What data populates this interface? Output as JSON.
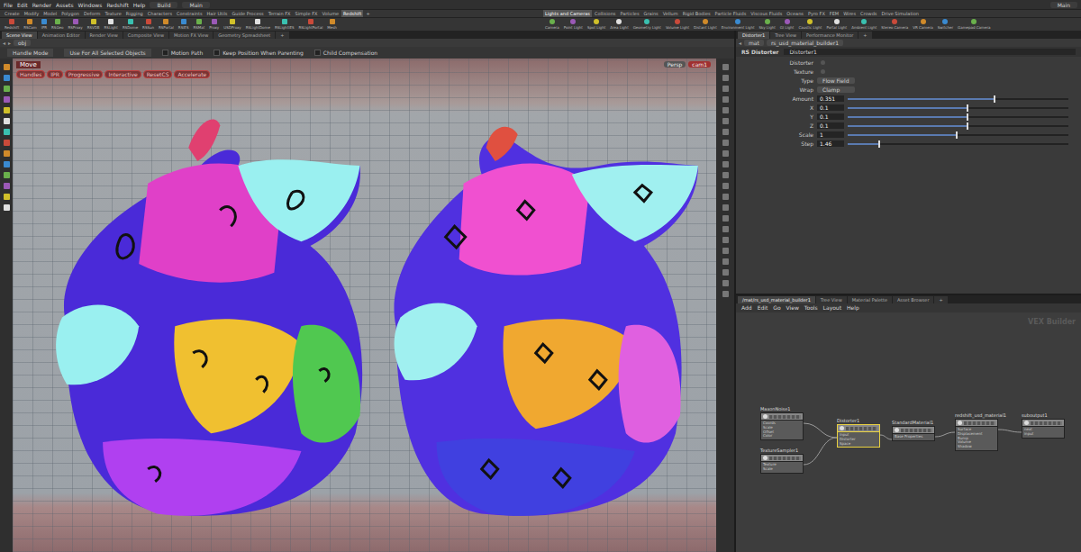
{
  "menubar": {
    "items": [
      "File",
      "Edit",
      "Render",
      "Assets",
      "Windows",
      "Redshift",
      "Help"
    ],
    "desktop": "Build",
    "context": "Main",
    "right_context": "Main"
  },
  "shelf_tabs_left": [
    {
      "label": "Create",
      "selected": false
    },
    {
      "label": "Modify",
      "selected": false
    },
    {
      "label": "Model",
      "selected": false
    },
    {
      "label": "Polygon",
      "selected": false
    },
    {
      "label": "Deform",
      "selected": false
    },
    {
      "label": "Texture",
      "selected": false
    },
    {
      "label": "Rigging",
      "selected": false
    },
    {
      "label": "Characters",
      "selected": false
    },
    {
      "label": "Constraints",
      "selected": false
    },
    {
      "label": "Hair Utils",
      "selected": false
    },
    {
      "label": "Guide Process",
      "selected": false
    },
    {
      "label": "Terrain FX",
      "selected": false
    },
    {
      "label": "Simple FX",
      "selected": false
    },
    {
      "label": "Volume",
      "selected": false
    },
    {
      "label": "Redshift",
      "selected": true
    },
    {
      "label": "+",
      "selected": false
    }
  ],
  "shelf_tabs_right": [
    {
      "label": "Lights and Cameras",
      "selected": true
    },
    {
      "label": "Collisions",
      "selected": false
    },
    {
      "label": "Particles",
      "selected": false
    },
    {
      "label": "Grains",
      "selected": false
    },
    {
      "label": "Vellum",
      "selected": false
    },
    {
      "label": "Rigid Bodies",
      "selected": false
    },
    {
      "label": "Particle Fluids",
      "selected": false
    },
    {
      "label": "Viscous Fluids",
      "selected": false
    },
    {
      "label": "Oceans",
      "selected": false
    },
    {
      "label": "Pyro FX",
      "selected": false
    },
    {
      "label": "FEM",
      "selected": false
    },
    {
      "label": "Wires",
      "selected": false
    },
    {
      "label": "Crowds",
      "selected": false
    },
    {
      "label": "Drive Simulation",
      "selected": false
    }
  ],
  "shelf_tools_left": [
    "Redshift",
    "RSCam",
    "IPR",
    "RSGeo",
    "RSProxy",
    "RSVDB",
    "RSLight",
    "RSDome",
    "RSSun",
    "RSPortal",
    "RSIES",
    "RSMat",
    "Proxy",
    "USDProxy",
    "RSLightDome",
    "RSLightIES",
    "RSLightPortal",
    "Mesh"
  ],
  "shelf_tools_right": [
    "Camera",
    "Point Light",
    "Spot Light",
    "Area Light",
    "Geometry Light",
    "Volume Light",
    "Distant Light",
    "Environment Light",
    "Sky Light",
    "GI Light",
    "Caustic Light",
    "Portal Light",
    "Ambient Light",
    "Stereo Camera",
    "VR Camera",
    "Switcher",
    "Gamepad Camera"
  ],
  "pane_tabs_left": [
    {
      "label": "Scene View",
      "selected": true
    },
    {
      "label": "Animation Editor",
      "selected": false
    },
    {
      "label": "Render View",
      "selected": false
    },
    {
      "label": "Composite View",
      "selected": false
    },
    {
      "label": "Motion FX View",
      "selected": false
    },
    {
      "label": "Geometry Spreadsheet",
      "selected": false
    },
    {
      "label": "+",
      "selected": false
    }
  ],
  "viewport": {
    "path": "obj",
    "toolbar": [
      {
        "label": "Handle Mode",
        "kind": "button",
        "checked": false
      },
      {
        "label": "Use For All Selected Objects",
        "kind": "button",
        "checked": false
      },
      {
        "label": "Motion Path",
        "kind": "checkbox",
        "checked": false
      },
      {
        "label": "Keep Position When Parenting",
        "kind": "checkbox",
        "checked": false
      },
      {
        "label": "Child Compensation",
        "kind": "checkbox",
        "checked": false
      }
    ],
    "tool": "Move",
    "render_buttons": [
      "Handles",
      "IPR",
      "Progressive",
      "Interactive",
      "ResetCS",
      "Accelerate"
    ],
    "view": "Persp",
    "camera": "cam1"
  },
  "right_pane_tabs": [
    {
      "label": "Distorter1",
      "selected": true
    },
    {
      "label": "Tree View",
      "selected": false
    },
    {
      "label": "Performance Monitor",
      "selected": false
    },
    {
      "label": "+",
      "selected": false
    }
  ],
  "parameters": {
    "path": [
      "mat",
      "rs_usd_material_builder1"
    ],
    "node_type": "RS Distorter",
    "node_name": "Distorter1",
    "rows": [
      {
        "label": "Distorter",
        "kind": "link",
        "value": ""
      },
      {
        "label": "Texture",
        "kind": "link",
        "value": ""
      },
      {
        "label": "Type",
        "kind": "menu",
        "value": "Flow Field"
      },
      {
        "label": "Wrap",
        "kind": "menu",
        "value": "Clamp"
      },
      {
        "label": "Amount",
        "kind": "slider",
        "value": "0.351",
        "level": 0.66
      },
      {
        "label": "X",
        "kind": "slider",
        "value": "0.1",
        "level": 0.54
      },
      {
        "label": "Y",
        "kind": "slider",
        "value": "0.1",
        "level": 0.54
      },
      {
        "label": "Z",
        "kind": "slider",
        "value": "0.1",
        "level": 0.54
      },
      {
        "label": "Scale",
        "kind": "slider",
        "value": "1",
        "level": 0.49
      },
      {
        "label": "Step",
        "kind": "slider",
        "value": "1.46",
        "level": 0.14
      }
    ]
  },
  "network": {
    "tabs": [
      {
        "label": "/mat/rs_usd_material_builder1",
        "selected": true
      },
      {
        "label": "Tree View",
        "selected": false
      },
      {
        "label": "Material Palette",
        "selected": false
      },
      {
        "label": "Asset Browser",
        "selected": false
      },
      {
        "label": "+",
        "selected": false
      }
    ],
    "menu": [
      "Add",
      "Edit",
      "Go",
      "View",
      "Tools",
      "Layout",
      "Help"
    ],
    "context_label": "VEX Builder",
    "nodes": [
      {
        "name": "MaxonNoise1",
        "selected": false,
        "ports": [
          "Coords",
          "Scale",
          "Offset",
          "Color"
        ]
      },
      {
        "name": "TextureSampler1",
        "selected": false,
        "ports": [
          "Texture",
          "Scale"
        ]
      },
      {
        "name": "Distorter1",
        "selected": true,
        "ports": [
          "Input",
          "Distorter",
          "Space"
        ]
      },
      {
        "name": "StandardMaterial1",
        "selected": false,
        "ports": [
          "Base Properties"
        ]
      },
      {
        "name": "redshift_usd_material1",
        "selected": false,
        "ports": [
          "Surface",
          "Displacement",
          "Bump",
          "Volume",
          "Shadow"
        ]
      },
      {
        "name": "suboutput1",
        "selected": false,
        "ports": [
          "next",
          "input"
        ]
      }
    ],
    "wires": [
      {
        "from": 0,
        "to": 2
      },
      {
        "from": 1,
        "to": 2
      },
      {
        "from": 2,
        "to": 3
      },
      {
        "from": 3,
        "to": 4
      },
      {
        "from": 4,
        "to": 5
      }
    ]
  }
}
